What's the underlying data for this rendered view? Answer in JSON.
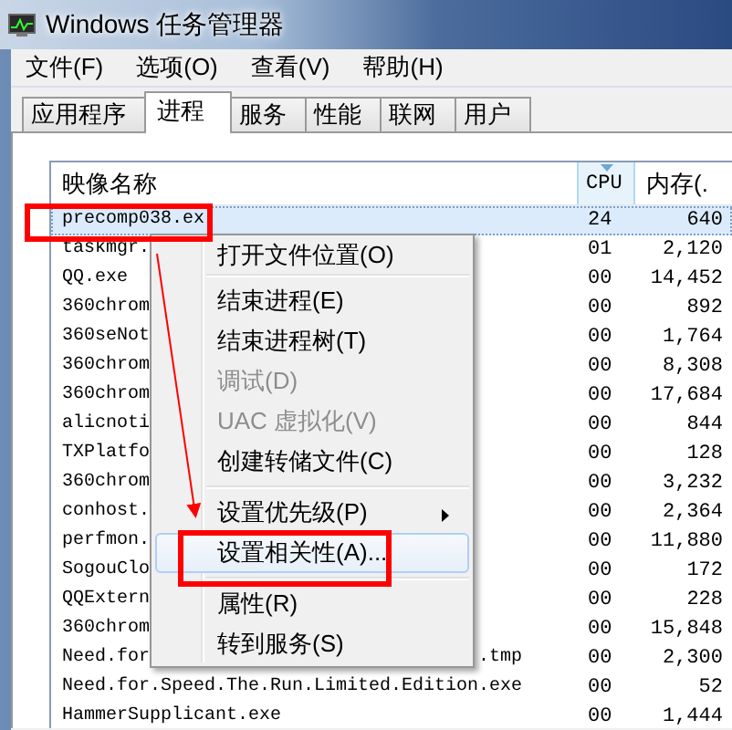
{
  "window": {
    "title": "Windows 任务管理器"
  },
  "menu_bar": [
    "文件(F)",
    "选项(O)",
    "查看(V)",
    "帮助(H)"
  ],
  "tabs": [
    {
      "label": "应用程序",
      "selected": false
    },
    {
      "label": "进程",
      "selected": true
    },
    {
      "label": "服务",
      "selected": false
    },
    {
      "label": "性能",
      "selected": false
    },
    {
      "label": "联网",
      "selected": false
    },
    {
      "label": "用户",
      "selected": false
    }
  ],
  "process_table": {
    "columns": [
      {
        "label": "映像名称",
        "sorted": false
      },
      {
        "label": "CPU",
        "sorted": true
      },
      {
        "label": "内存(.",
        "sorted": false
      }
    ],
    "rows": [
      {
        "name": "precomp038.ex",
        "cpu": "24",
        "memory": "640",
        "selected": true
      },
      {
        "name": "taskmgr.",
        "cpu": "01",
        "memory": "2,120",
        "selected": false
      },
      {
        "name": "QQ.exe",
        "cpu": "00",
        "memory": "14,452",
        "selected": false
      },
      {
        "name": "360chrom",
        "cpu": "00",
        "memory": "892",
        "selected": false
      },
      {
        "name": "360seNot",
        "cpu": "00",
        "memory": "1,764",
        "selected": false
      },
      {
        "name": "360chrom",
        "cpu": "00",
        "memory": "8,308",
        "selected": false
      },
      {
        "name": "360chrom",
        "cpu": "00",
        "memory": "17,684",
        "selected": false
      },
      {
        "name": "alicnoti",
        "cpu": "00",
        "memory": "844",
        "selected": false
      },
      {
        "name": "TXPlatfo",
        "cpu": "00",
        "memory": "128",
        "selected": false
      },
      {
        "name": "360chrom",
        "cpu": "00",
        "memory": "3,232",
        "selected": false
      },
      {
        "name": "conhost.",
        "cpu": "00",
        "memory": "2,364",
        "selected": false
      },
      {
        "name": "perfmon.",
        "cpu": "00",
        "memory": "11,880",
        "selected": false
      },
      {
        "name": "SogouClo",
        "cpu": "00",
        "memory": "172",
        "selected": false
      },
      {
        "name": "QQExtern",
        "cpu": "00",
        "memory": "228",
        "selected": false
      },
      {
        "name": "360chrom",
        "cpu": "00",
        "memory": "15,848",
        "selected": false
      },
      {
        "name": "Need.for",
        "tail": ".tmp",
        "cpu": "00",
        "memory": "2,300",
        "selected": false
      },
      {
        "name": "Need.for.Speed.The.Run.Limited.Edition.exe",
        "cpu": "00",
        "memory": "52",
        "selected": false
      },
      {
        "name": "HammerSupplicant.exe",
        "cpu": "00",
        "memory": "1,444",
        "selected": false
      }
    ]
  },
  "context_menu": {
    "items": [
      {
        "kind": "item",
        "label": "打开文件位置(O)",
        "disabled": false,
        "selected": false,
        "submenu": false
      },
      {
        "kind": "separator"
      },
      {
        "kind": "item",
        "label": "结束进程(E)",
        "disabled": false,
        "selected": false,
        "submenu": false
      },
      {
        "kind": "item",
        "label": "结束进程树(T)",
        "disabled": false,
        "selected": false,
        "submenu": false
      },
      {
        "kind": "item",
        "label": "调试(D)",
        "disabled": true,
        "selected": false,
        "submenu": false
      },
      {
        "kind": "item",
        "label": "UAC 虚拟化(V)",
        "disabled": true,
        "selected": false,
        "submenu": false
      },
      {
        "kind": "item",
        "label": "创建转储文件(C)",
        "disabled": false,
        "selected": false,
        "submenu": false
      },
      {
        "kind": "separator"
      },
      {
        "kind": "item",
        "label": "设置优先级(P)",
        "disabled": false,
        "selected": false,
        "submenu": true
      },
      {
        "kind": "item",
        "label": "设置相关性(A)...",
        "disabled": false,
        "selected": true,
        "submenu": false
      },
      {
        "kind": "separator"
      },
      {
        "kind": "item",
        "label": "属性(R)",
        "disabled": false,
        "selected": false,
        "submenu": false
      },
      {
        "kind": "item",
        "label": "转到服务(S)",
        "disabled": false,
        "selected": false,
        "submenu": false
      }
    ]
  }
}
